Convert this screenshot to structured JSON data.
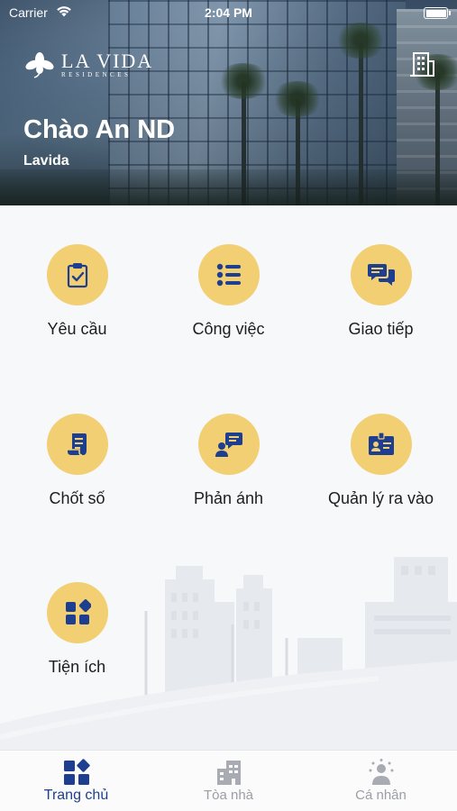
{
  "status_bar": {
    "carrier": "Carrier",
    "time": "2:04 PM"
  },
  "header": {
    "logo_name": "LA VIDA",
    "logo_subtitle": "RESIDENCES",
    "greeting": "Chào An ND",
    "building": "Lavida",
    "building_icon": "building-icon"
  },
  "menu": [
    {
      "label": "Yêu cầu",
      "icon": "clipboard-check-icon"
    },
    {
      "label": "Công việc",
      "icon": "task-list-icon"
    },
    {
      "label": "Giao tiếp",
      "icon": "chat-bubbles-icon"
    },
    {
      "label": "Chốt số",
      "icon": "meter-reading-icon"
    },
    {
      "label": "Phản ánh",
      "icon": "feedback-icon"
    },
    {
      "label": "Quản lý ra vào",
      "icon": "id-badge-icon"
    },
    {
      "label": "Tiện ích",
      "icon": "utilities-grid-icon"
    }
  ],
  "tabbar": {
    "tabs": [
      {
        "label": "Trang chủ",
        "icon": "home-grid-icon",
        "active": true
      },
      {
        "label": "Tòa nhà",
        "icon": "building-icon",
        "active": false
      },
      {
        "label": "Cá nhân",
        "icon": "person-icon",
        "active": false
      }
    ]
  },
  "colors": {
    "accent": "#f2cf72",
    "icon_navy": "#1e3f8f",
    "tab_inactive": "#9b9ea4",
    "background": "#f7f8fa"
  }
}
